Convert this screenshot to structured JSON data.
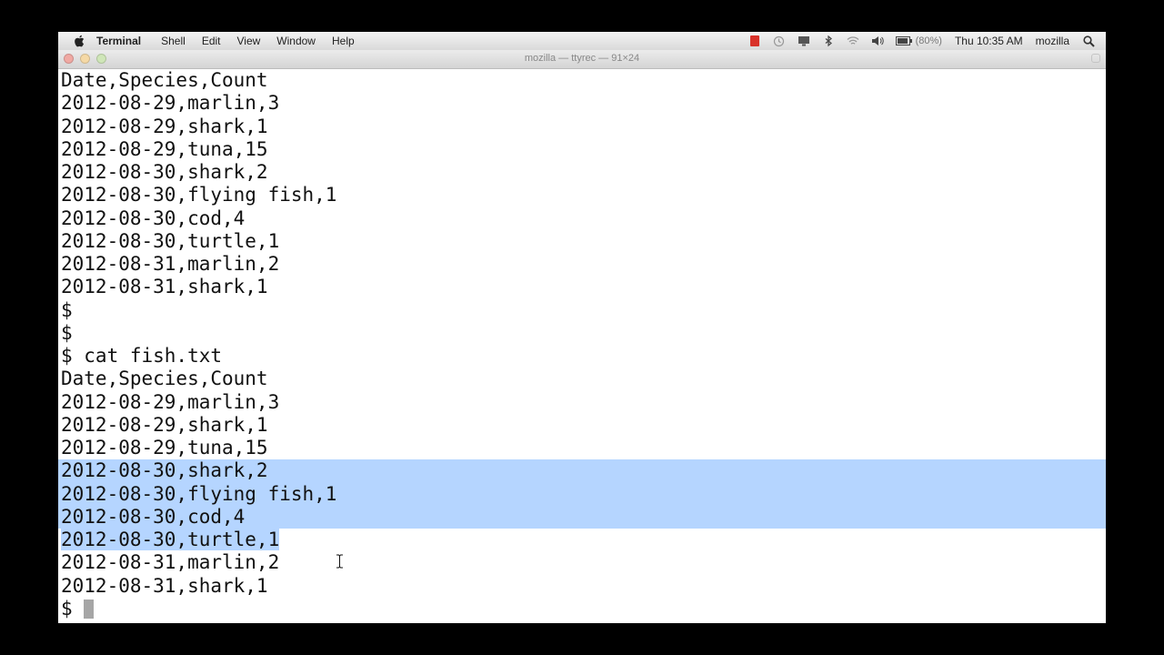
{
  "menubar": {
    "app_name": "Terminal",
    "menus": [
      "Shell",
      "Edit",
      "View",
      "Window",
      "Help"
    ],
    "battery": "(80%)",
    "clock": "Thu 10:35 AM",
    "user": "mozilla",
    "colors": {
      "record": "#d8322a"
    }
  },
  "window": {
    "title": "mozilla — ttyrec — 91×24"
  },
  "terminal": {
    "lines": [
      "Date,Species,Count",
      "2012-08-29,marlin,3",
      "2012-08-29,shark,1",
      "2012-08-29,tuna,15",
      "2012-08-30,shark,2",
      "2012-08-30,flying fish,1",
      "2012-08-30,cod,4",
      "2012-08-30,turtle,1",
      "2012-08-31,marlin,2",
      "2012-08-31,shark,1",
      "$",
      "$",
      "$ cat fish.txt",
      "Date,Species,Count",
      "2012-08-29,marlin,3",
      "2012-08-29,shark,1",
      "2012-08-29,tuna,15",
      "2012-08-30,shark,2",
      "2012-08-30,flying fish,1",
      "2012-08-30,cod,4",
      "2012-08-30,turtle,1",
      "2012-08-31,marlin,2",
      "2012-08-31,shark,1"
    ],
    "prompt": "$ ",
    "selection_color": "#b5d5ff"
  }
}
